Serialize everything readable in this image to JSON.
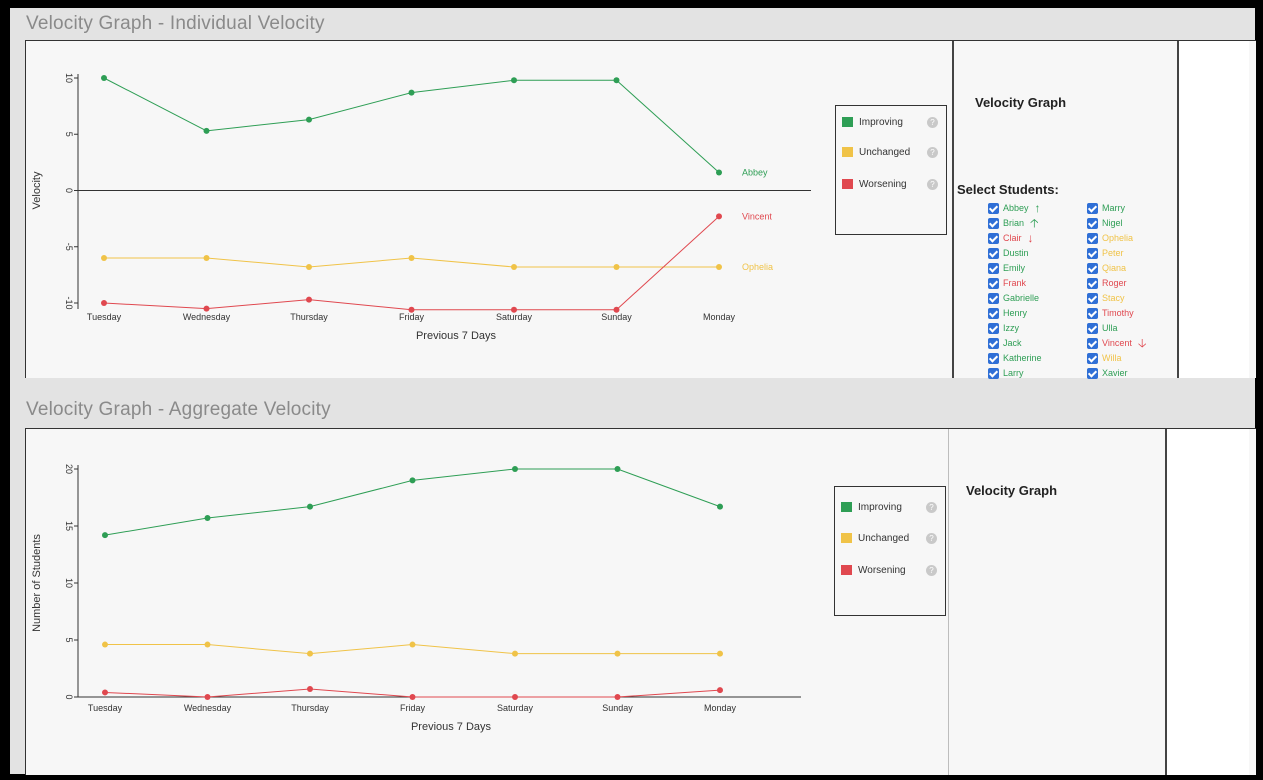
{
  "colors": {
    "improving": "#2e9e55",
    "unchanged": "#f0c348",
    "worsening": "#e0484f",
    "student_text_green": "#2e9e55"
  },
  "titles": {
    "individual": "Velocity Graph - Individual Velocity",
    "aggregate": "Velocity Graph - Aggregate Velocity"
  },
  "legend": {
    "items": [
      {
        "label": "Improving",
        "color": "#2e9e55",
        "icon": "help-icon"
      },
      {
        "label": "Unchanged",
        "color": "#f0c348",
        "icon": "help-icon"
      },
      {
        "label": "Worsening",
        "color": "#e0484f",
        "icon": "help-icon"
      }
    ]
  },
  "sidebar": {
    "heading": "Velocity Graph",
    "select_label": "Select Students:",
    "students_left": [
      {
        "name": "Abbey",
        "status": "improving",
        "arrow": "↑"
      },
      {
        "name": "Brian",
        "status": "improving",
        "arrow": "🡡"
      },
      {
        "name": "Clair",
        "status": "worsening",
        "arrow": "↓"
      },
      {
        "name": "Dustin",
        "status": "improving",
        "arrow": ""
      },
      {
        "name": "Emily",
        "status": "improving",
        "arrow": ""
      },
      {
        "name": "Frank",
        "status": "worsening",
        "arrow": ""
      },
      {
        "name": "Gabrielle",
        "status": "improving",
        "arrow": ""
      },
      {
        "name": "Henry",
        "status": "improving",
        "arrow": ""
      },
      {
        "name": "Izzy",
        "status": "improving",
        "arrow": ""
      },
      {
        "name": "Jack",
        "status": "improving",
        "arrow": ""
      },
      {
        "name": "Katherine",
        "status": "improving",
        "arrow": ""
      },
      {
        "name": "Larry",
        "status": "improving",
        "arrow": ""
      }
    ],
    "students_right": [
      {
        "name": "Marry",
        "status": "improving",
        "arrow": ""
      },
      {
        "name": "Nigel",
        "status": "improving",
        "arrow": ""
      },
      {
        "name": "Ophelia",
        "status": "unchanged",
        "arrow": ""
      },
      {
        "name": "Peter",
        "status": "unchanged",
        "arrow": ""
      },
      {
        "name": "Qiana",
        "status": "unchanged",
        "arrow": ""
      },
      {
        "name": "Roger",
        "status": "worsening",
        "arrow": ""
      },
      {
        "name": "Stacy",
        "status": "unchanged",
        "arrow": ""
      },
      {
        "name": "Timothy",
        "status": "worsening",
        "arrow": ""
      },
      {
        "name": "Ulla",
        "status": "improving",
        "arrow": ""
      },
      {
        "name": "Vincent",
        "status": "worsening",
        "arrow": "🡣"
      },
      {
        "name": "Willa",
        "status": "unchanged",
        "arrow": ""
      },
      {
        "name": "Xavier",
        "status": "improving",
        "arrow": ""
      }
    ]
  },
  "aggregate_sidebar": {
    "heading": "Velocity Graph"
  },
  "chart_data": [
    {
      "type": "line",
      "xlabel": "Previous 7 Days",
      "ylabel": "Velocity",
      "categories": [
        "Tuesday",
        "Wednesday",
        "Thursday",
        "Friday",
        "Saturday",
        "Sunday",
        "Monday"
      ],
      "ylim": [
        -10,
        10
      ],
      "yticks": [
        10,
        5,
        0,
        -5,
        -10
      ],
      "zero_line": true,
      "series": [
        {
          "name": "Abbey",
          "status": "improving",
          "values": [
            10,
            5.3,
            6.3,
            8.7,
            9.8,
            9.8,
            1.6
          ]
        },
        {
          "name": "Ophelia",
          "status": "unchanged",
          "values": [
            -6,
            -6,
            -6.8,
            -6,
            -6.8,
            -6.8,
            -6.8
          ]
        },
        {
          "name": "Vincent",
          "status": "worsening",
          "values": [
            -10,
            -10.5,
            -9.7,
            -10.6,
            -10.6,
            -10.6,
            -2.3
          ]
        }
      ]
    },
    {
      "type": "line",
      "xlabel": "Previous 7 Days",
      "ylabel": "Number of Students",
      "categories": [
        "Tuesday",
        "Wednesday",
        "Thursday",
        "Friday",
        "Saturday",
        "Sunday",
        "Monday"
      ],
      "ylim": [
        0,
        20
      ],
      "yticks": [
        20,
        15,
        10,
        5,
        0
      ],
      "series": [
        {
          "status": "improving",
          "values": [
            14.2,
            15.7,
            16.7,
            19,
            20,
            20,
            16.7
          ]
        },
        {
          "status": "unchanged",
          "values": [
            4.6,
            4.6,
            3.8,
            4.6,
            3.8,
            3.8,
            3.8
          ]
        },
        {
          "status": "worsening",
          "values": [
            0.4,
            0,
            0.7,
            0,
            0,
            0,
            0.6
          ]
        }
      ]
    }
  ]
}
